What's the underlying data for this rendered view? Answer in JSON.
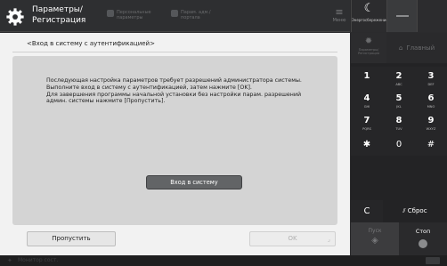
{
  "header": {
    "title_line1": "Параметры/",
    "title_line2": "Регистрация",
    "tab1_line1": "Персональные",
    "tab1_line2": "параметры",
    "tab2_line1": "Парам. адм./",
    "tab2_line2": "портала",
    "menu_label": "Меню"
  },
  "top_right": {
    "sleep_label": "Энергосбережение"
  },
  "dialog": {
    "title": "<Вход в систему с аутентификацией>",
    "message_line1": "Последующая настройка параметров требует разрешений администратора системы.",
    "message_line2": "Выполните вход в систему с аутентификацией, затем нажмите [OK].",
    "message_line3": "Для завершения программы начальной установки без настройки парам. разрешений",
    "message_line4": "админ. системы нажмите [Пропустить].",
    "login_button": "Вход в систему",
    "skip_button": "Пропустить",
    "ok_button": "OK"
  },
  "keypad": {
    "settings_label_line1": "Параметры/",
    "settings_label_line2": "Регистрация",
    "home_label": "Главный",
    "keys": [
      {
        "digit": "1",
        "sub": ""
      },
      {
        "digit": "2",
        "sub": "ABC"
      },
      {
        "digit": "3",
        "sub": "DEF"
      },
      {
        "digit": "4",
        "sub": "GHI"
      },
      {
        "digit": "5",
        "sub": "JKL"
      },
      {
        "digit": "6",
        "sub": "MNO"
      },
      {
        "digit": "7",
        "sub": "PQRS"
      },
      {
        "digit": "8",
        "sub": "TUV"
      },
      {
        "digit": "9",
        "sub": "WXYZ"
      },
      {
        "digit": "✱",
        "sub": ""
      },
      {
        "digit": "0",
        "sub": ""
      },
      {
        "digit": "#",
        "sub": ""
      }
    ],
    "c_key": "C",
    "clear_label": "Сброс",
    "start_label": "Пуск",
    "stop_label": "Стоп"
  },
  "status": {
    "text": "Монитор сост."
  },
  "icons": {
    "gear": "gear-icon",
    "moon": "moon-icon",
    "home": "home-icon",
    "menu": "menu-icon",
    "start": "start-diamond-icon",
    "stop": "stop-icon",
    "clear": "clear-slash-icon"
  },
  "colors": {
    "dialog_bg": "#f2f2f2",
    "panel_bg": "#d4d4d4",
    "login_button": "#626466",
    "keypad_bg": "#232325"
  }
}
